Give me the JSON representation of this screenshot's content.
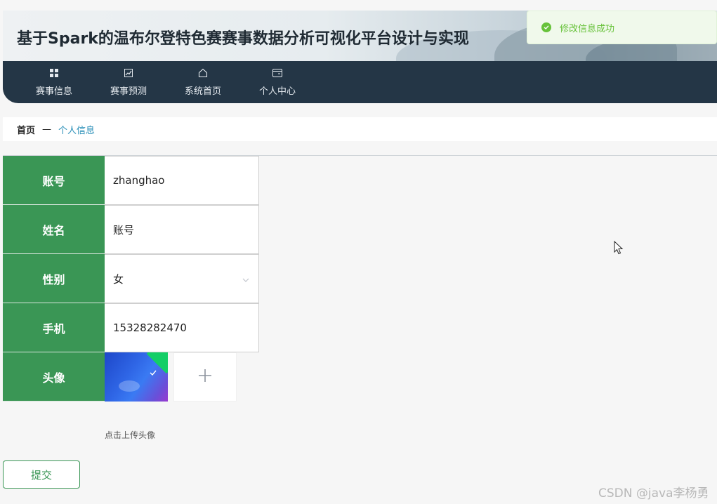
{
  "header": {
    "title": "基于Spark的温布尔登特色赛赛事数据分析可视化平台设计与实现"
  },
  "nav": {
    "items": [
      {
        "label": "赛事信息",
        "icon": "grid-icon"
      },
      {
        "label": "赛事预测",
        "icon": "chart-icon"
      },
      {
        "label": "系统首页",
        "icon": "home-icon"
      },
      {
        "label": "个人中心",
        "icon": "wallet-icon"
      }
    ]
  },
  "toast": {
    "message": "修改信息成功",
    "color": "#67c23a"
  },
  "breadcrumb": {
    "home": "首页",
    "separator": "—",
    "current": "个人信息"
  },
  "form": {
    "account": {
      "label": "账号",
      "value": "zhanghao"
    },
    "name": {
      "label": "姓名",
      "value": "账号"
    },
    "gender": {
      "label": "性别",
      "value": "女"
    },
    "phone": {
      "label": "手机",
      "value": "15328282470"
    },
    "avatar": {
      "label": "头像",
      "hint": "点击上传头像"
    },
    "submit_label": "提交"
  },
  "colors": {
    "label_bg": "#3a9655",
    "nav_bg": "#243646",
    "link": "#2a8fb8"
  },
  "watermark": "CSDN @java李杨勇"
}
